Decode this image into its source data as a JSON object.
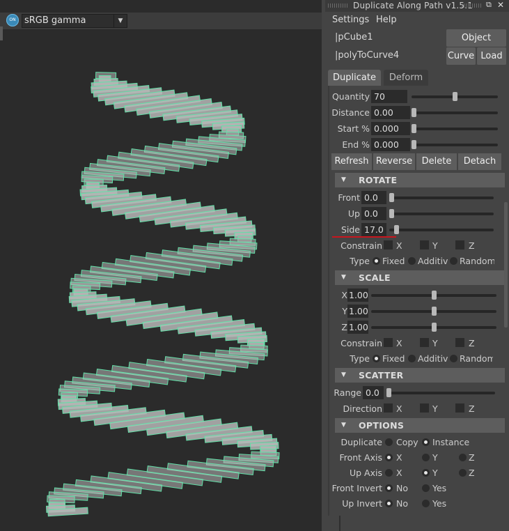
{
  "viewport": {
    "colorspace_toggle": "ON",
    "colorspace_label": "sRGB gamma",
    "colorspace_arrow": "▼"
  },
  "panel": {
    "title": "Duplicate Along Path v1.5.1",
    "float_icon": "⧉",
    "close_icon": "✕",
    "menu": [
      "Settings",
      "Help"
    ],
    "object_path": "|pCube1",
    "object_button": "Object",
    "curve_path": "|polyToCurve4",
    "curve_button": "Curve",
    "load_button": "Load",
    "tabs": [
      "Duplicate",
      "Deform"
    ],
    "duplicate": {
      "quantity": {
        "label": "Quantity",
        "value": "70",
        "level": 0.5
      },
      "distance": {
        "label": "Distance",
        "value": "0.00",
        "level": 0.0
      },
      "start": {
        "label": "Start %",
        "value": "0.000",
        "level": 0.0
      },
      "end": {
        "label": "End %",
        "value": "0.000",
        "level": 0.0
      }
    },
    "actions": [
      "Refresh",
      "Reverse",
      "Delete",
      "Detach"
    ],
    "rotate": {
      "title": "ROTATE",
      "front": {
        "label": "Front",
        "value": "0.0",
        "level": 0.0
      },
      "up": {
        "label": "Up",
        "value": "0.0",
        "level": 0.0
      },
      "side": {
        "label": "Side",
        "value": "17.0",
        "level": 0.047
      },
      "constrain_label": "Constrain",
      "axes": [
        "X",
        "Y",
        "Z"
      ],
      "type_label": "Type",
      "type_options": [
        "Fixed",
        "Additive",
        "Random"
      ],
      "type_selected": "Fixed"
    },
    "scale": {
      "title": "SCALE",
      "x": {
        "label": "X",
        "value": "1.00",
        "level": 0.5
      },
      "y": {
        "label": "Y",
        "value": "1.00",
        "level": 0.5
      },
      "z": {
        "label": "Z",
        "value": "1.00",
        "level": 0.5
      },
      "constrain_label": "Constrain",
      "axes": [
        "X",
        "Y",
        "Z"
      ],
      "type_label": "Type",
      "type_options": [
        "Fixed",
        "Additive",
        "Random"
      ],
      "type_selected": "Fixed"
    },
    "scatter": {
      "title": "SCATTER",
      "range": {
        "label": "Range",
        "value": "0.0",
        "level": 0.0
      },
      "direction_label": "Direction",
      "axes": [
        "X",
        "Y",
        "Z"
      ]
    },
    "options": {
      "title": "OPTIONS",
      "duplicate_label": "Duplicate",
      "duplicate_options": [
        "Copy",
        "Instance"
      ],
      "duplicate_selected": "Instance",
      "front_axis_label": "Front Axis",
      "front_axis_options": [
        "X",
        "Y",
        "Z"
      ],
      "front_axis_selected": "X",
      "up_axis_label": "Up Axis",
      "up_axis_options": [
        "X",
        "Y",
        "Z"
      ],
      "up_axis_selected": "Y",
      "front_invert_label": "Front Invert",
      "front_invert_options": [
        "No",
        "Yes"
      ],
      "front_invert_selected": "No",
      "up_invert_label": "Up Invert",
      "up_invert_options": [
        "No",
        "Yes"
      ],
      "up_invert_selected": "No"
    }
  },
  "colors": {
    "viewport_bg": "#2b2b2b",
    "wire": "#62e0a8",
    "step_fill": "#b6b6b6",
    "accent_underline": "#c8161e"
  }
}
